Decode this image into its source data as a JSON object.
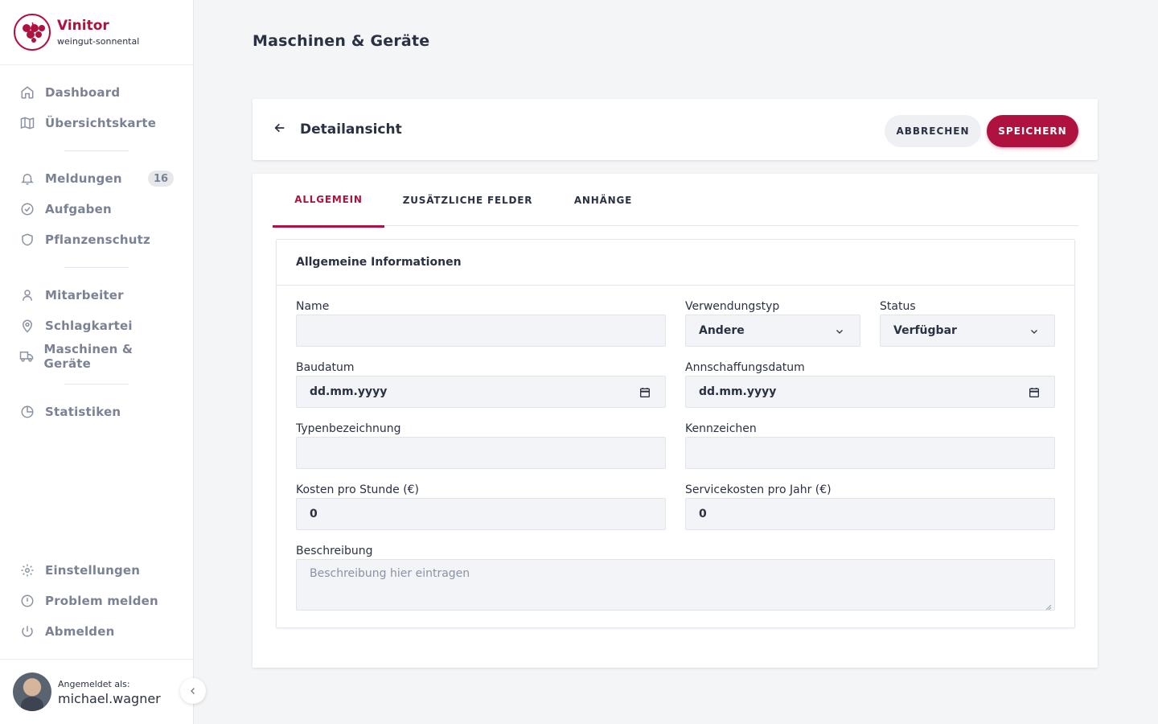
{
  "brand": {
    "name": "Vinitor",
    "sub": "weingut-sonnental"
  },
  "nav": {
    "dashboard": "Dashboard",
    "overview_map": "Übersichtskarte",
    "messages": "Meldungen",
    "messages_count": "16",
    "tasks": "Aufgaben",
    "plant_protection": "Pflanzenschutz",
    "employees": "Mitarbeiter",
    "field_register": "Schlagkartei",
    "machines": "Maschinen & Geräte",
    "statistics": "Statistiken",
    "settings": "Einstellungen",
    "report_problem": "Problem melden",
    "logout": "Abmelden"
  },
  "user": {
    "label": "Angemeldet als:",
    "name": "michael.wagner"
  },
  "page": {
    "title": "Maschinen & Geräte"
  },
  "header": {
    "title": "Detailansicht",
    "cancel_label": "ABBRECHEN",
    "save_label": "SPEICHERN"
  },
  "tabs": [
    {
      "label": "ALLGEMEIN",
      "active": true
    },
    {
      "label": "ZUSÄTZLICHE FELDER",
      "active": false
    },
    {
      "label": "ANHÄNGE",
      "active": false
    }
  ],
  "form": {
    "section_title": "Allgemeine Informationen",
    "name": {
      "label": "Name",
      "value": ""
    },
    "usage_type": {
      "label": "Verwendungstyp",
      "value": "Andere"
    },
    "status": {
      "label": "Status",
      "value": "Verfügbar"
    },
    "build_date": {
      "label": "Baudatum",
      "value": "dd.mm.yyyy"
    },
    "purchase_date": {
      "label": "Annschaffungsdatum",
      "value": "dd.mm.yyyy"
    },
    "type_designation": {
      "label": "Typenbezeichnung",
      "value": ""
    },
    "license_plate": {
      "label": "Kennzeichen",
      "value": ""
    },
    "cost_per_hour": {
      "label": "Kosten pro Stunde (€)",
      "value": "0"
    },
    "service_cost_per_year": {
      "label": "Servicekosten pro Jahr (€)",
      "value": "0"
    },
    "description": {
      "label": "Beschreibung",
      "placeholder": "Beschreibung hier eintragen"
    }
  },
  "colors": {
    "brand": "#b0123f",
    "text": "#2a3142",
    "muted": "#7a8294",
    "field_bg": "#f2f4f7"
  }
}
